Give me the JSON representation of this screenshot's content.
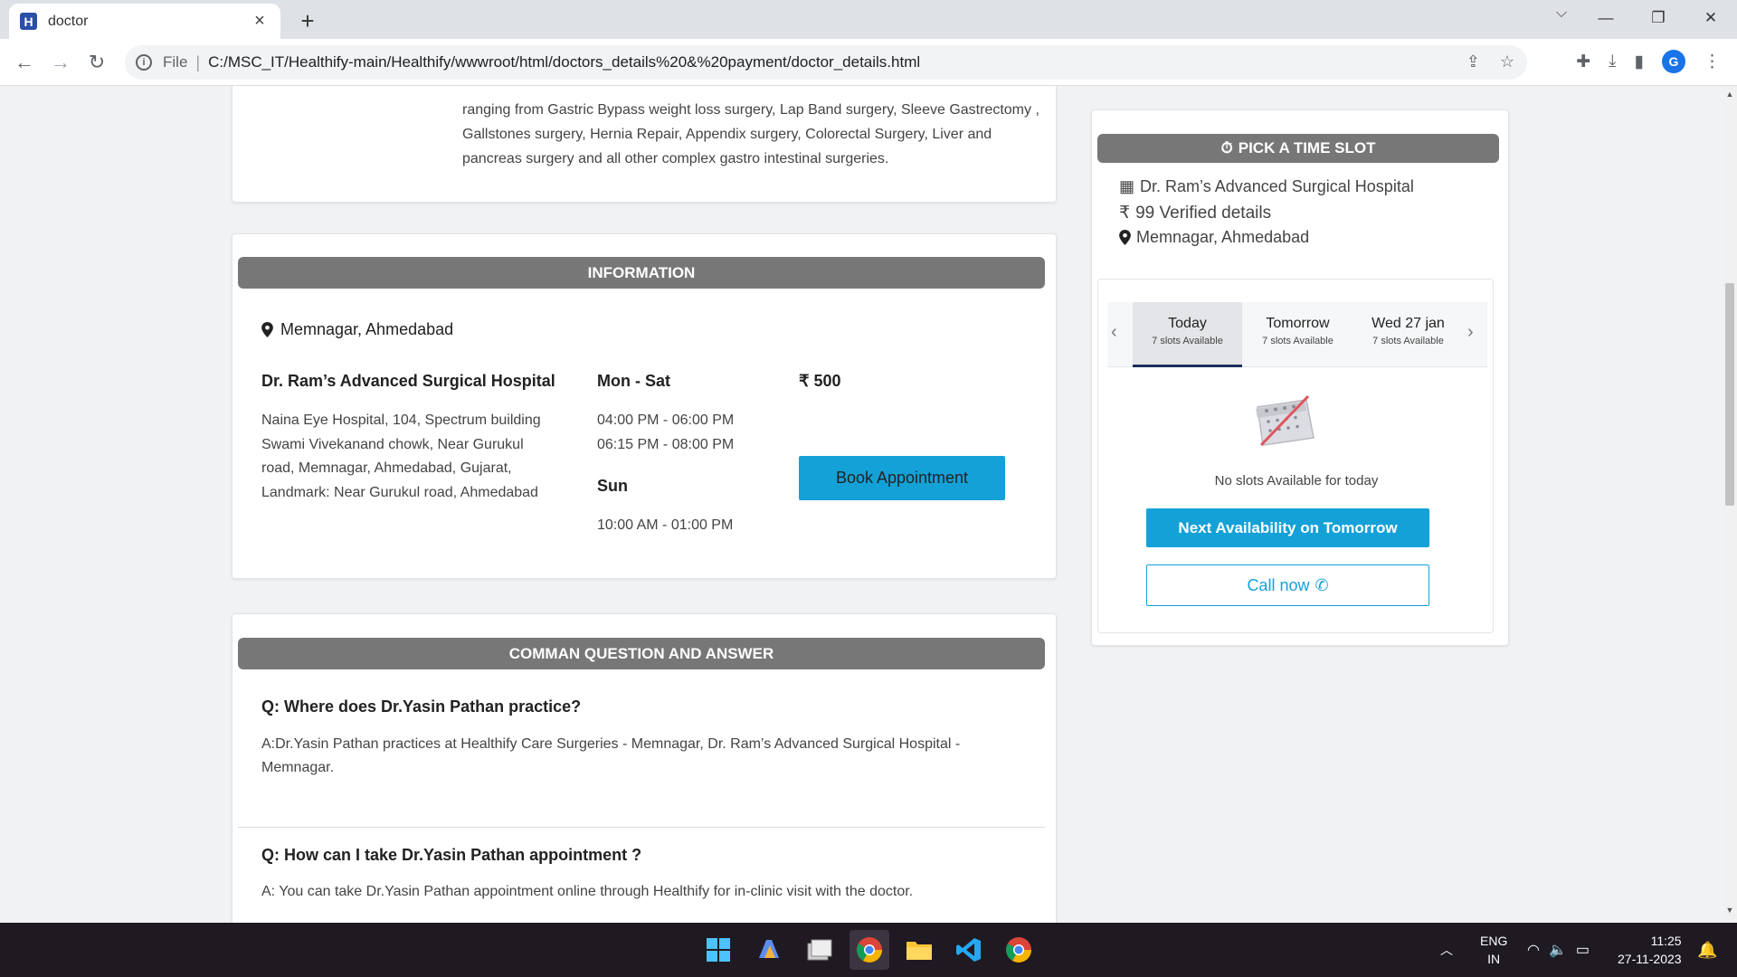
{
  "browser": {
    "tab_title": "doctor",
    "tab_favicon_letter": "H",
    "new_tab_symbol": "+",
    "address_scheme": "File",
    "address_url": "C:/MSC_IT/Healthify-main/Healthify/wwwroot/html/doctors_details%20&%20payment/doctor_details.html",
    "profile_initial": "G"
  },
  "about": {
    "text": "ranging from Gastric Bypass weight loss surgery, Lap Band surgery, Sleeve Gastrectomy , Gallstones surgery, Hernia Repair, Appendix surgery, Colorectal Surgery, Liver and pancreas surgery and all other complex gastro intestinal surgeries."
  },
  "information": {
    "header": "INFORMATION",
    "location": "Memnagar, Ahmedabad",
    "hospital_name": "Dr. Ram’s Advanced Surgical Hospital",
    "hospital_address": "Naina Eye Hospital, 104, Spectrum building Swami Vivekanand chowk, Near Gurukul road, Memnagar, Ahmedabad, Gujarat, Landmark: Near Gurukul road, Ahmedabad",
    "weekday_label": "Mon - Sat",
    "weekday_slot_1": "04:00 PM - 06:00 PM",
    "weekday_slot_2": "06:15 PM - 08:00 PM",
    "sunday_label": "Sun",
    "sunday_slot": "10:00 AM - 01:00 PM",
    "fee": "₹ 500",
    "book_button": "Book Appointment"
  },
  "faq": {
    "header": "COMMAN QUESTION AND ANSWER",
    "items": [
      {
        "question": "Q: Where does Dr.Yasin Pathan practice?",
        "answer": "A:Dr.Yasin Pathan practices at Healthify Care Surgeries - Memnagar, Dr. Ram’s Advanced Surgical Hospital - Memnagar."
      },
      {
        "question": "Q: How can I take Dr.Yasin Pathan appointment ?",
        "answer": "A: You can take Dr.Yasin Pathan appointment online through Healthify for in-clinic visit with the doctor."
      }
    ]
  },
  "time_slot": {
    "header": "PICK A TIME SLOT",
    "hospital": "Dr. Ram’s Advanced Surgical Hospital",
    "fee_text": "99 Verified details",
    "rupee": "₹",
    "location": "Memnagar, Ahmedabad",
    "days": [
      {
        "name": "Today",
        "slots": "7 slots Available",
        "active": true
      },
      {
        "name": "Tomorrow",
        "slots": "7 slots Available",
        "active": false
      },
      {
        "name": "Wed 27 jan",
        "slots": "7 slots Available",
        "active": false
      }
    ],
    "no_slots_text": "No slots Available for today",
    "next_button": "Next Availability on Tomorrow",
    "call_button": "Call now"
  },
  "taskbar": {
    "lang_top": "ENG",
    "lang_bottom": "IN",
    "time": "11:25",
    "date": "27-11-2023"
  },
  "colors": {
    "accent": "#14a1d8",
    "section_header": "#777777",
    "active_tab_underline": "#1f2f5a"
  }
}
